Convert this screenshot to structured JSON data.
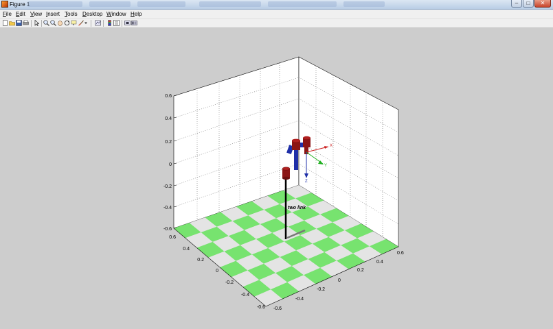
{
  "window": {
    "title": "Figure 1",
    "controls": {
      "minimize": "–",
      "maximize": "□",
      "close": "✕"
    }
  },
  "menu": [
    {
      "label": "File",
      "mnemonic": "F"
    },
    {
      "label": "Edit",
      "mnemonic": "E"
    },
    {
      "label": "View",
      "mnemonic": "V"
    },
    {
      "label": "Insert",
      "mnemonic": "I"
    },
    {
      "label": "Tools",
      "mnemonic": "T"
    },
    {
      "label": "Desktop",
      "mnemonic": "D"
    },
    {
      "label": "Window",
      "mnemonic": "W"
    },
    {
      "label": "Help",
      "mnemonic": "H"
    }
  ],
  "toolbar": {
    "icons": [
      "new-figure-icon",
      "open-file-icon",
      "save-icon",
      "print-icon",
      "edit-plot-arrow-icon",
      "zoom-in-icon",
      "zoom-out-icon",
      "pan-hand-icon",
      "rotate-3d-icon",
      "data-cursor-icon",
      "brush-icon",
      "link-plot-icon",
      "colorbar-icon",
      "legend-icon",
      "hide-plot-tools-icon",
      "show-plot-tools-icon"
    ]
  },
  "plot": {
    "z_ticks": [
      "0.6",
      "0.4",
      "0.2",
      "0",
      "-0.2",
      "-0.4",
      "-0.6"
    ],
    "x_ticks_left": [
      "0.6",
      "0.4",
      "0.2",
      "0",
      "-0.2",
      "-0.4",
      "-0.6"
    ],
    "y_ticks_right": [
      "-0.6",
      "-0.4",
      "-0.2",
      "0",
      "0.2",
      "0.4",
      "0.6"
    ],
    "annotation": "two link",
    "frame_axes": {
      "x": "X",
      "y": "Y",
      "z": "Z"
    },
    "colors": {
      "background": "#cdcdcd",
      "axes_face": "#ffffff",
      "floor_green": "#77e36f",
      "floor_light": "#e4e4e4",
      "link_dark_red": "#8b1414",
      "link_blue": "#1f2fa8",
      "pole": "#000000",
      "x_arrow": "#cc2020",
      "y_arrow": "#20b020",
      "z_arrow": "#1f2fa8"
    }
  }
}
